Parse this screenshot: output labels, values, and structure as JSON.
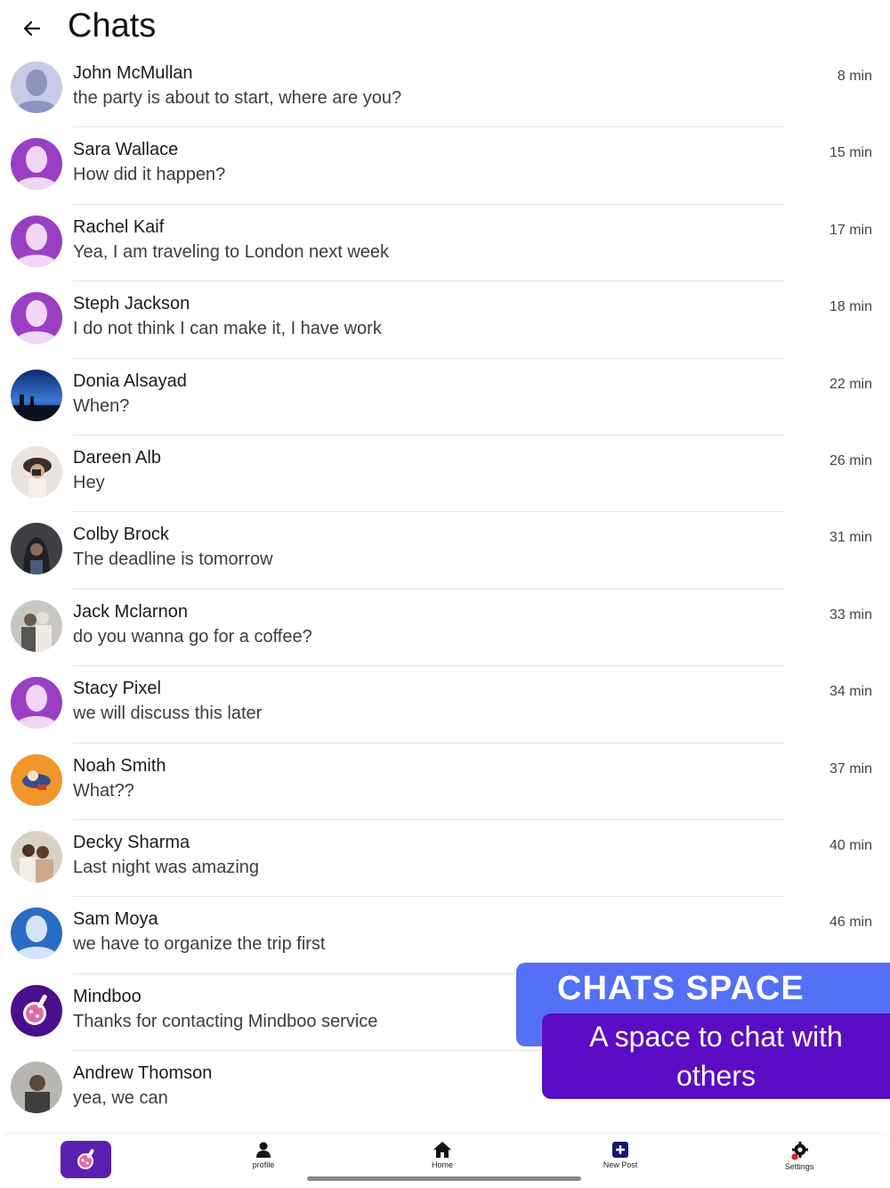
{
  "header": {
    "title": "Chats",
    "back_icon": "arrow-left-icon"
  },
  "chats": [
    {
      "name": "John McMullan",
      "message": "the party is about to start, where are you?",
      "time": "8 min",
      "avatar": "default-avatar-gray"
    },
    {
      "name": "Sara Wallace",
      "message": "How did it happen?",
      "time": "15 min",
      "avatar": "default-avatar-purple"
    },
    {
      "name": "Rachel Kaif",
      "message": "Yea, I am traveling to London next week",
      "time": "17 min",
      "avatar": "default-avatar-purple"
    },
    {
      "name": "Steph Jackson",
      "message": "I do not think I can make it, I have work",
      "time": "18 min",
      "avatar": "default-avatar-purple"
    },
    {
      "name": "Donia Alsayad",
      "message": "When?",
      "time": "22 min",
      "avatar": "photo-night-sky"
    },
    {
      "name": "Dareen Alb",
      "message": "Hey",
      "time": "26 min",
      "avatar": "photo-camera-girl"
    },
    {
      "name": "Colby Brock",
      "message": "The deadline is tomorrow",
      "time": "31 min",
      "avatar": "photo-hooded-man"
    },
    {
      "name": "Jack Mclarnon",
      "message": "do you wanna go for a coffee?",
      "time": "33 min",
      "avatar": "photo-couple"
    },
    {
      "name": "Stacy Pixel",
      "message": "we will discuss this later",
      "time": "34 min",
      "avatar": "default-avatar-purple"
    },
    {
      "name": "Noah Smith",
      "message": "What??",
      "time": "37 min",
      "avatar": "cartoon-orange"
    },
    {
      "name": "Decky Sharma",
      "message": "Last night was amazing",
      "time": "40 min",
      "avatar": "photo-people"
    },
    {
      "name": "Sam Moya",
      "message": "we have to organize the trip first",
      "time": "46 min",
      "avatar": "default-avatar-blue"
    },
    {
      "name": "Mindboo",
      "message": "Thanks for contacting Mindboo service",
      "time": "",
      "avatar": "mindboo-logo"
    },
    {
      "name": "Andrew Thomson",
      "message": "yea, we can",
      "time": "",
      "avatar": "photo-man-portrait"
    }
  ],
  "promo": {
    "title": "CHATS SPACE",
    "subtitle": "A space to chat with others"
  },
  "nav": {
    "app_icon": "mindboo-logo-icon",
    "items": [
      {
        "label": "profile",
        "icon": "person-icon"
      },
      {
        "label": "Home",
        "icon": "home-icon"
      },
      {
        "label": "New Post",
        "icon": "plus-square-icon"
      },
      {
        "label": "Settings",
        "icon": "gear-icon"
      }
    ]
  },
  "colors": {
    "promo_blue": "#5470f5",
    "promo_purple": "#5a0cc4",
    "avatar_purple": "#9a3fc4",
    "avatar_blue": "#2a6cc4",
    "nav_app": "#5b1fae",
    "settings_dot": "#e02020"
  }
}
